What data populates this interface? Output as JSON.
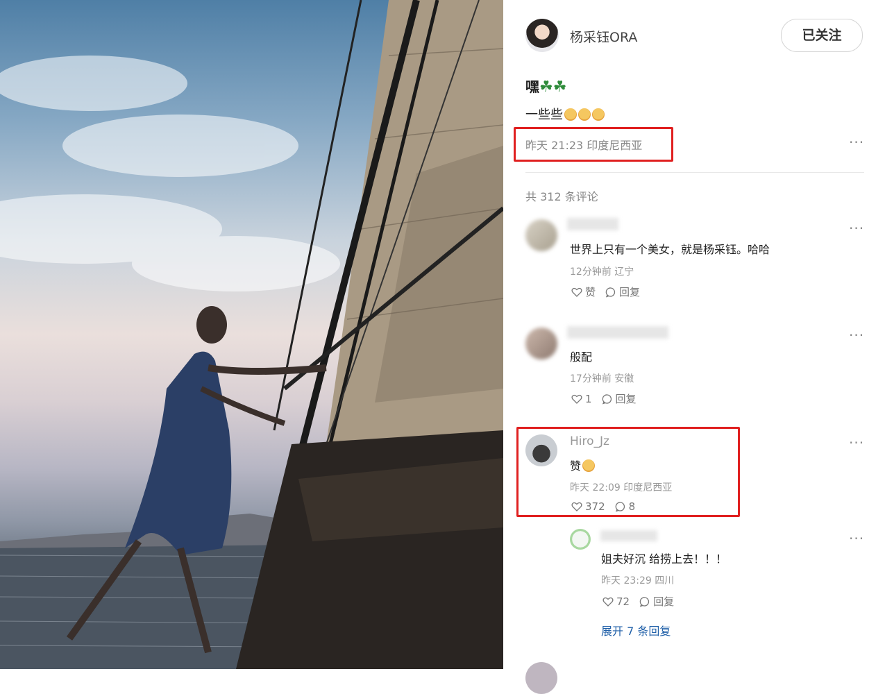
{
  "author": {
    "name": "杨采钰ORA",
    "follow_label": "已关注"
  },
  "post": {
    "title": "嘿",
    "title_emoji": [
      "☘",
      "☘"
    ],
    "body": "一些些",
    "time": "昨天 21:23",
    "location": "印度尼西亚"
  },
  "comments_header": {
    "count_text": "共 312 条评论"
  },
  "comments": [
    {
      "name": "",
      "text": "世界上只有一个美女，就是杨采钰。哈哈",
      "time": "12分钟前",
      "location": "辽宁",
      "like_label": "赞",
      "reply_label": "回复"
    },
    {
      "name": "",
      "text": "般配",
      "time": "17分钟前",
      "location": "安徽",
      "like_label": "1",
      "reply_label": "回复"
    },
    {
      "name": "Hiro_Jz",
      "text": "赞",
      "time": "昨天 22:09",
      "location": "印度尼西亚",
      "like_label": "372",
      "reply_label": "8"
    }
  ],
  "reply": {
    "name": "",
    "text": "姐夫好沉 给捞上去！！！",
    "time": "昨天 23:29",
    "location": "四川",
    "like_label": "72",
    "reply_label": "回复"
  },
  "expand_label": "展开 7 条回复",
  "more_icon": "more-dots-icon",
  "accent_color": "#e02020"
}
